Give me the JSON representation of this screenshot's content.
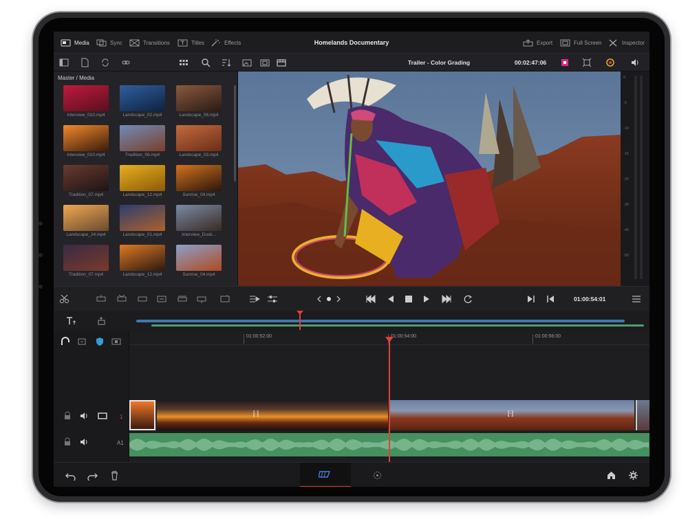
{
  "topbar": {
    "tabs": [
      {
        "label": "Media",
        "icon": "media-icon"
      },
      {
        "label": "Sync",
        "icon": "sync-icon"
      },
      {
        "label": "Transitions",
        "icon": "transitions-icon"
      },
      {
        "label": "Titles",
        "icon": "titles-icon"
      },
      {
        "label": "Effects",
        "icon": "effects-icon"
      }
    ],
    "project_title": "Homelands Documentary",
    "right": [
      {
        "label": "Export",
        "icon": "export-icon"
      },
      {
        "label": "Full Screen",
        "icon": "fullscreen-icon"
      },
      {
        "label": "Inspector",
        "icon": "inspector-icon"
      }
    ]
  },
  "toolbar": {
    "timeline_name": "Trailer - Color Grading",
    "timecode": "00:02:47:06"
  },
  "media_pool": {
    "breadcrumb": "Master / Media",
    "clips": [
      {
        "name": "Interview_010.mp4",
        "colors": [
          "#c01a3e",
          "#5a0f1e"
        ]
      },
      {
        "name": "Landscape_02.mp4",
        "colors": [
          "#2f5f9e",
          "#0e2240"
        ]
      },
      {
        "name": "Landscape_06.mp4",
        "colors": [
          "#8a5a3e",
          "#2a1a14"
        ]
      },
      {
        "name": "Interview_010.mp4",
        "colors": [
          "#f28a2c",
          "#3a1a0c"
        ]
      },
      {
        "name": "Tradition_06.mp4",
        "colors": [
          "#6f8cb8",
          "#7a3f2a"
        ]
      },
      {
        "name": "Landscape_03.mp4",
        "colors": [
          "#c46a3e",
          "#6a2e18"
        ]
      },
      {
        "name": "Tradition_07.mp4",
        "colors": [
          "#6a3a2e",
          "#1e1416"
        ]
      },
      {
        "name": "Landscape_12.mp4",
        "colors": [
          "#e8b020",
          "#8a5a08"
        ]
      },
      {
        "name": "Sunrise_04.mp4",
        "colors": [
          "#d4721e",
          "#2a160c"
        ]
      },
      {
        "name": "Landscape_24.mp4",
        "colors": [
          "#f0a850",
          "#6a4a30"
        ]
      },
      {
        "name": "Landscape_01.mp4",
        "colors": [
          "#2a3e70",
          "#b0602a"
        ]
      },
      {
        "name": "Interview_Dusk...",
        "colors": [
          "#7a8aa4",
          "#3a2a24"
        ]
      },
      {
        "name": "Tradition_07.mp4",
        "colors": [
          "#3a2a44",
          "#7a3a2a"
        ]
      },
      {
        "name": "Landscape_12.mp4",
        "colors": [
          "#e07a24",
          "#2a1810"
        ]
      },
      {
        "name": "Sunrise_04.mp4",
        "colors": [
          "#8aa0c8",
          "#b04a20"
        ]
      }
    ]
  },
  "viewer": {
    "meter_scale": [
      "0",
      "-5",
      "-10",
      "-15",
      "-20",
      "-30",
      "-40",
      "-50"
    ]
  },
  "transport": {
    "timecode": "01:00:54:01"
  },
  "timeline": {
    "ruler": [
      "01:00:52:00",
      "01:00:54:00",
      "01:00:56:00"
    ],
    "video_track": "1",
    "audio_track": "A1"
  },
  "colors": {
    "accent": "#e2403a",
    "audio": "#4fa06c",
    "playhead": "#e2403a"
  }
}
